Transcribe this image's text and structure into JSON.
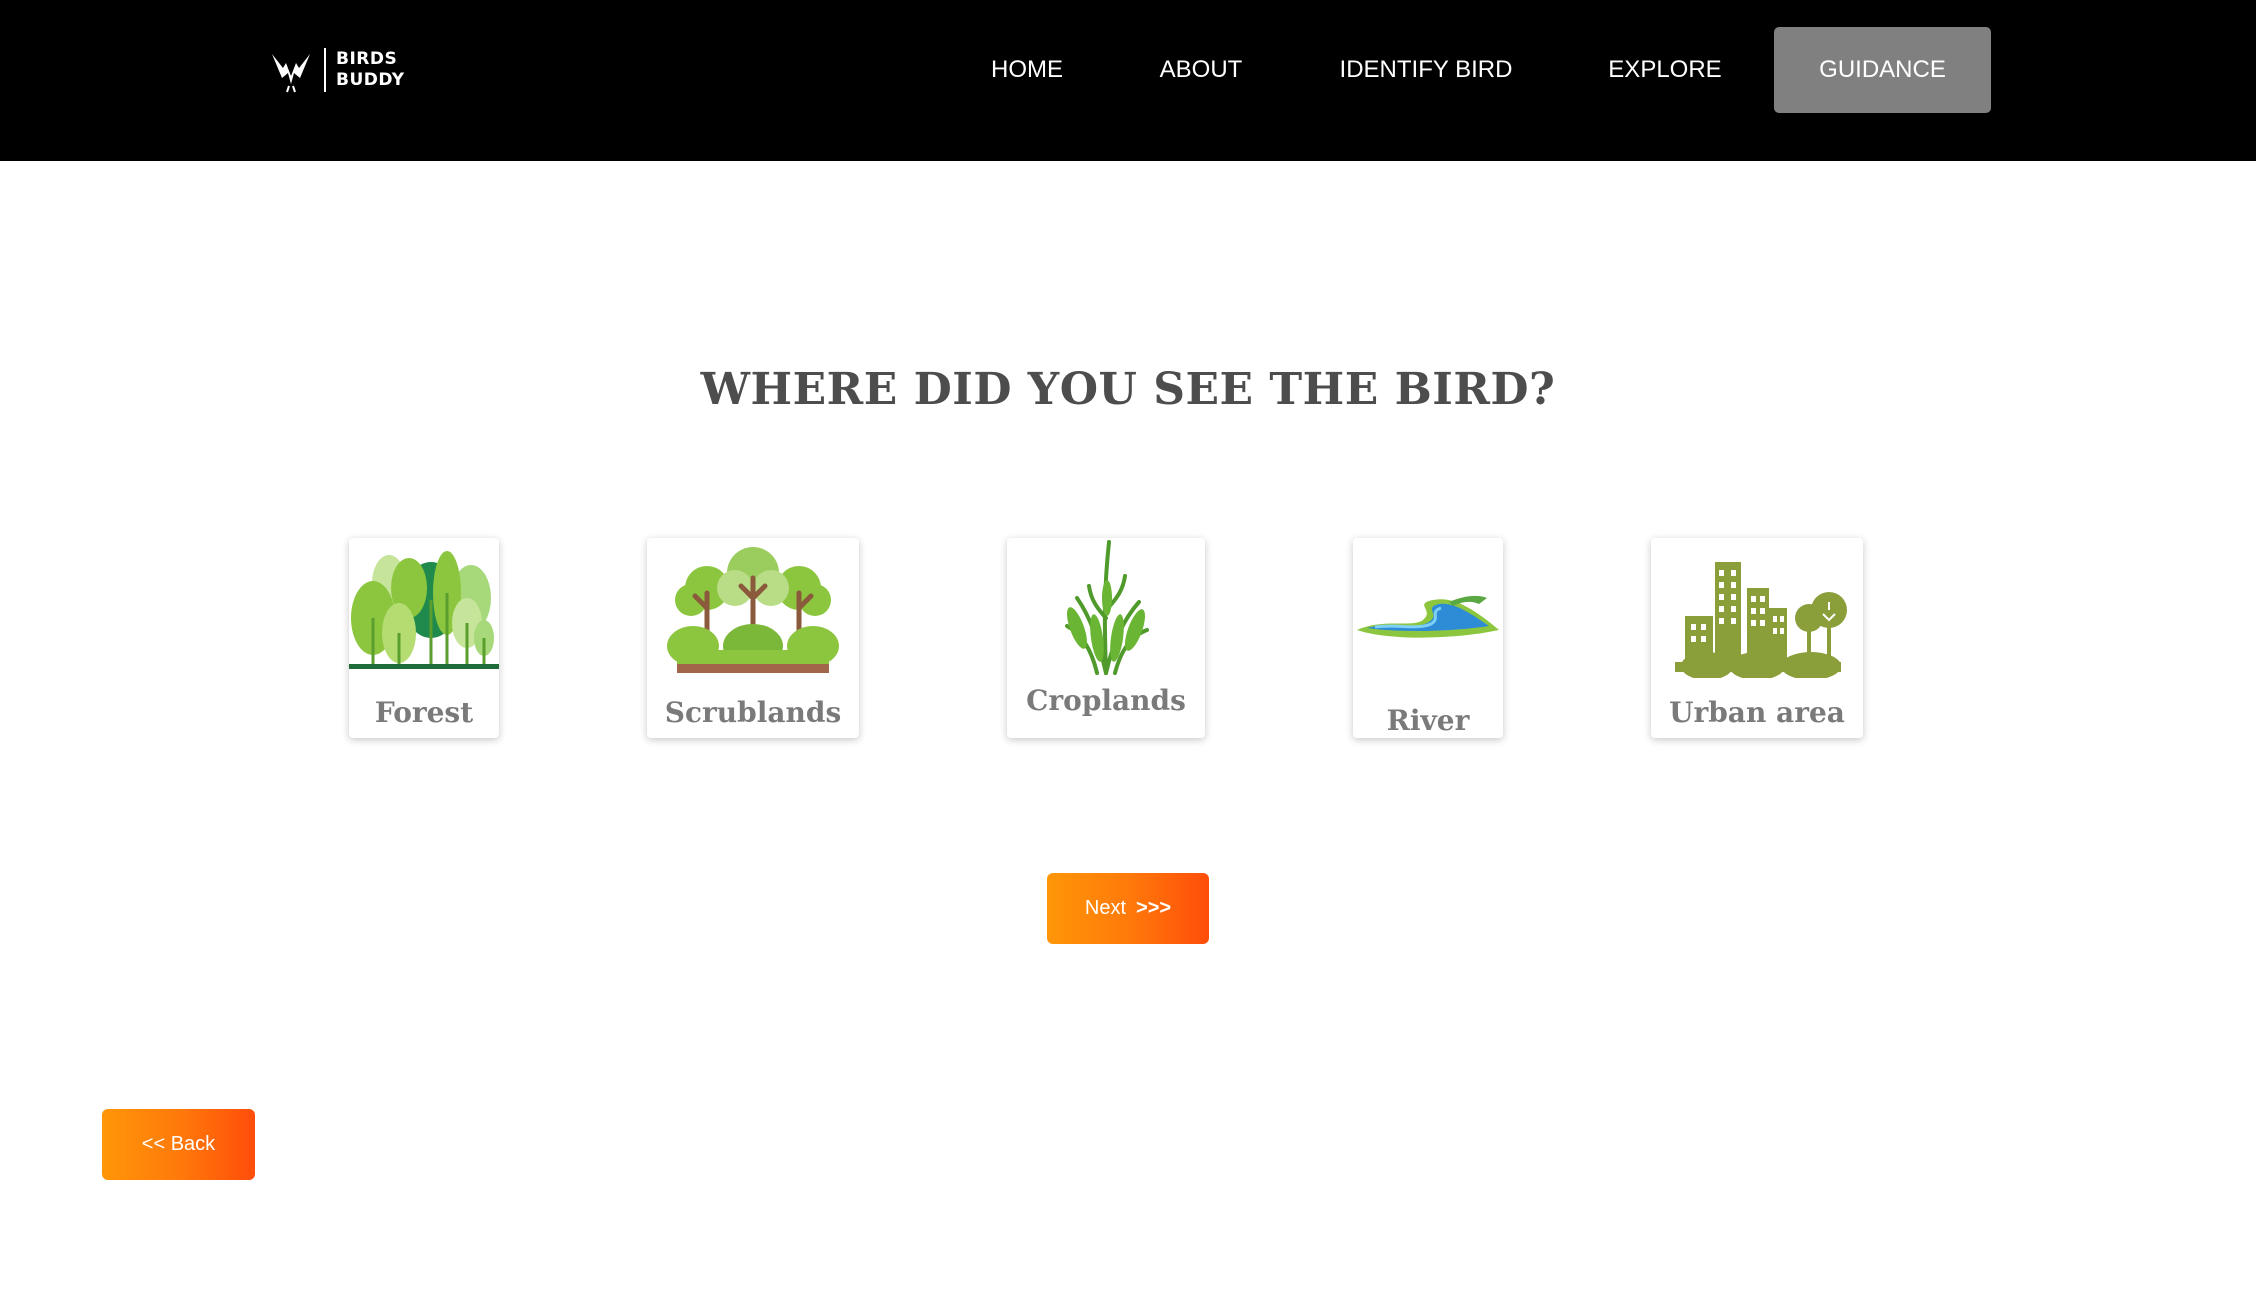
{
  "brand": {
    "line1": "BIRDS",
    "line2": "BUDDY"
  },
  "nav": [
    {
      "label": "HOME",
      "active": false
    },
    {
      "label": "ABOUT",
      "active": false
    },
    {
      "label": "IDENTIFY BIRD",
      "active": false
    },
    {
      "label": "EXPLORE",
      "active": false
    },
    {
      "label": "GUIDANCE",
      "active": true
    }
  ],
  "question": "WHERE DID YOU SEE THE BIRD?",
  "habitats": [
    {
      "label": "Forest",
      "icon": "forest-icon"
    },
    {
      "label": "Scrublands",
      "icon": "scrublands-icon"
    },
    {
      "label": "Croplands",
      "icon": "croplands-icon"
    },
    {
      "label": "River",
      "icon": "river-icon"
    },
    {
      "label": "Urban area",
      "icon": "urban-area-icon"
    }
  ],
  "next_button": {
    "label": "Next",
    "arrows": ">>>"
  },
  "back_button": {
    "label": "<< Back"
  },
  "colors": {
    "header_bg": "#000000",
    "active_nav_bg": "#808080",
    "button_gradient_start": "#ff9608",
    "button_gradient_end": "#ff4d0a",
    "heading_text": "#4d4d4d",
    "card_label_text": "#7a7a7a"
  }
}
